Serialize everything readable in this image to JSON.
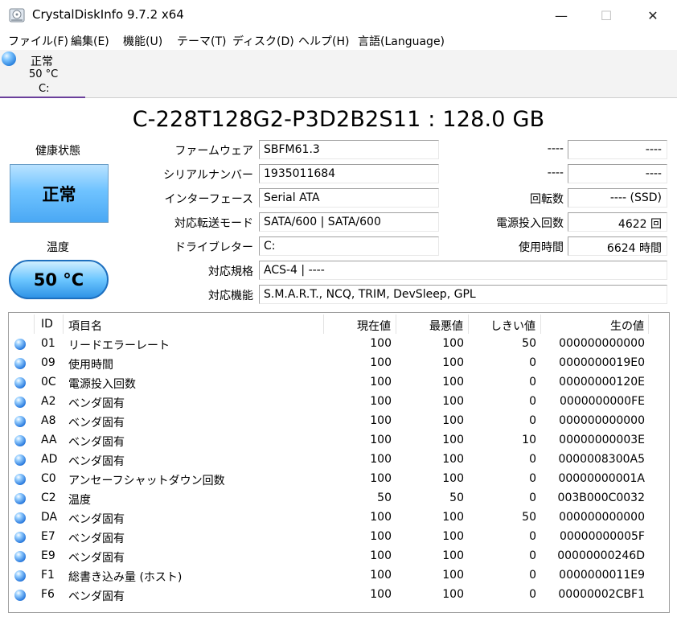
{
  "window": {
    "title": "CrystalDiskInfo 9.7.2 x64",
    "minimize_glyph": "—",
    "maximize_glyph": "☐",
    "close_glyph": "✕"
  },
  "menu": [
    "ファイル(F)",
    "編集(E)",
    "機能(U)",
    "テーマ(T)",
    "ディスク(D)",
    "ヘルプ(H)",
    "言語(Language)"
  ],
  "disk_tab": {
    "status": "正常",
    "temperature": "50 °C",
    "drive_letter": "C:",
    "indicator_color": "#1f78d8"
  },
  "disk": {
    "title": "C-228T128G2-P3D2B2S11 : 128.0 GB"
  },
  "health": {
    "label": "健康状態",
    "value": "正常",
    "color": "#6fc3ff"
  },
  "temperature": {
    "label": "温度",
    "value": "50 °C",
    "color": "#6cc6ff"
  },
  "info_left": {
    "firmware": {
      "label": "ファームウェア",
      "value": "SBFM61.3"
    },
    "serial": {
      "label": "シリアルナンバー",
      "value": "1935011684"
    },
    "interface": {
      "label": "インターフェース",
      "value": "Serial ATA"
    },
    "transfer_mode": {
      "label": "対応転送モード",
      "value": "SATA/600 | SATA/600"
    },
    "drive_letter": {
      "label": "ドライブレター",
      "value": "C:"
    },
    "standard": {
      "label": "対応規格",
      "value": "ACS-4 | ----"
    },
    "features": {
      "label": "対応機能",
      "value": "S.M.A.R.T., NCQ, TRIM, DevSleep, GPL"
    }
  },
  "info_right": {
    "blank1": {
      "label": "----",
      "value": "----"
    },
    "blank2": {
      "label": "----",
      "value": "----"
    },
    "rotation": {
      "label": "回転数",
      "value": "---- (SSD)"
    },
    "power_on_count": {
      "label": "電源投入回数",
      "value": "4622 回"
    },
    "power_on_hours": {
      "label": "使用時間",
      "value": "6624 時間"
    }
  },
  "smart": {
    "columns": [
      "ID",
      "項目名",
      "現在値",
      "最悪値",
      "しきい値",
      "生の値"
    ],
    "rows": [
      [
        "01",
        "リードエラーレート",
        "100",
        "100",
        "50",
        "000000000000"
      ],
      [
        "09",
        "使用時間",
        "100",
        "100",
        "0",
        "0000000019E0"
      ],
      [
        "0C",
        "電源投入回数",
        "100",
        "100",
        "0",
        "00000000120E"
      ],
      [
        "A2",
        "ベンダ固有",
        "100",
        "100",
        "0",
        "0000000000FE"
      ],
      [
        "A8",
        "ベンダ固有",
        "100",
        "100",
        "0",
        "000000000000"
      ],
      [
        "AA",
        "ベンダ固有",
        "100",
        "100",
        "10",
        "00000000003E"
      ],
      [
        "AD",
        "ベンダ固有",
        "100",
        "100",
        "0",
        "0000008300A5"
      ],
      [
        "C0",
        "アンセーフシャットダウン回数",
        "100",
        "100",
        "0",
        "00000000001A"
      ],
      [
        "C2",
        "温度",
        "50",
        "50",
        "0",
        "003B000C0032"
      ],
      [
        "DA",
        "ベンダ固有",
        "100",
        "100",
        "50",
        "000000000000"
      ],
      [
        "E7",
        "ベンダ固有",
        "100",
        "100",
        "0",
        "00000000005F"
      ],
      [
        "E9",
        "ベンダ固有",
        "100",
        "100",
        "0",
        "00000000246D"
      ],
      [
        "F1",
        "総書き込み量 (ホスト)",
        "100",
        "100",
        "0",
        "0000000011E9"
      ],
      [
        "F6",
        "ベンダ固有",
        "100",
        "100",
        "0",
        "00000002CBF1"
      ]
    ]
  }
}
